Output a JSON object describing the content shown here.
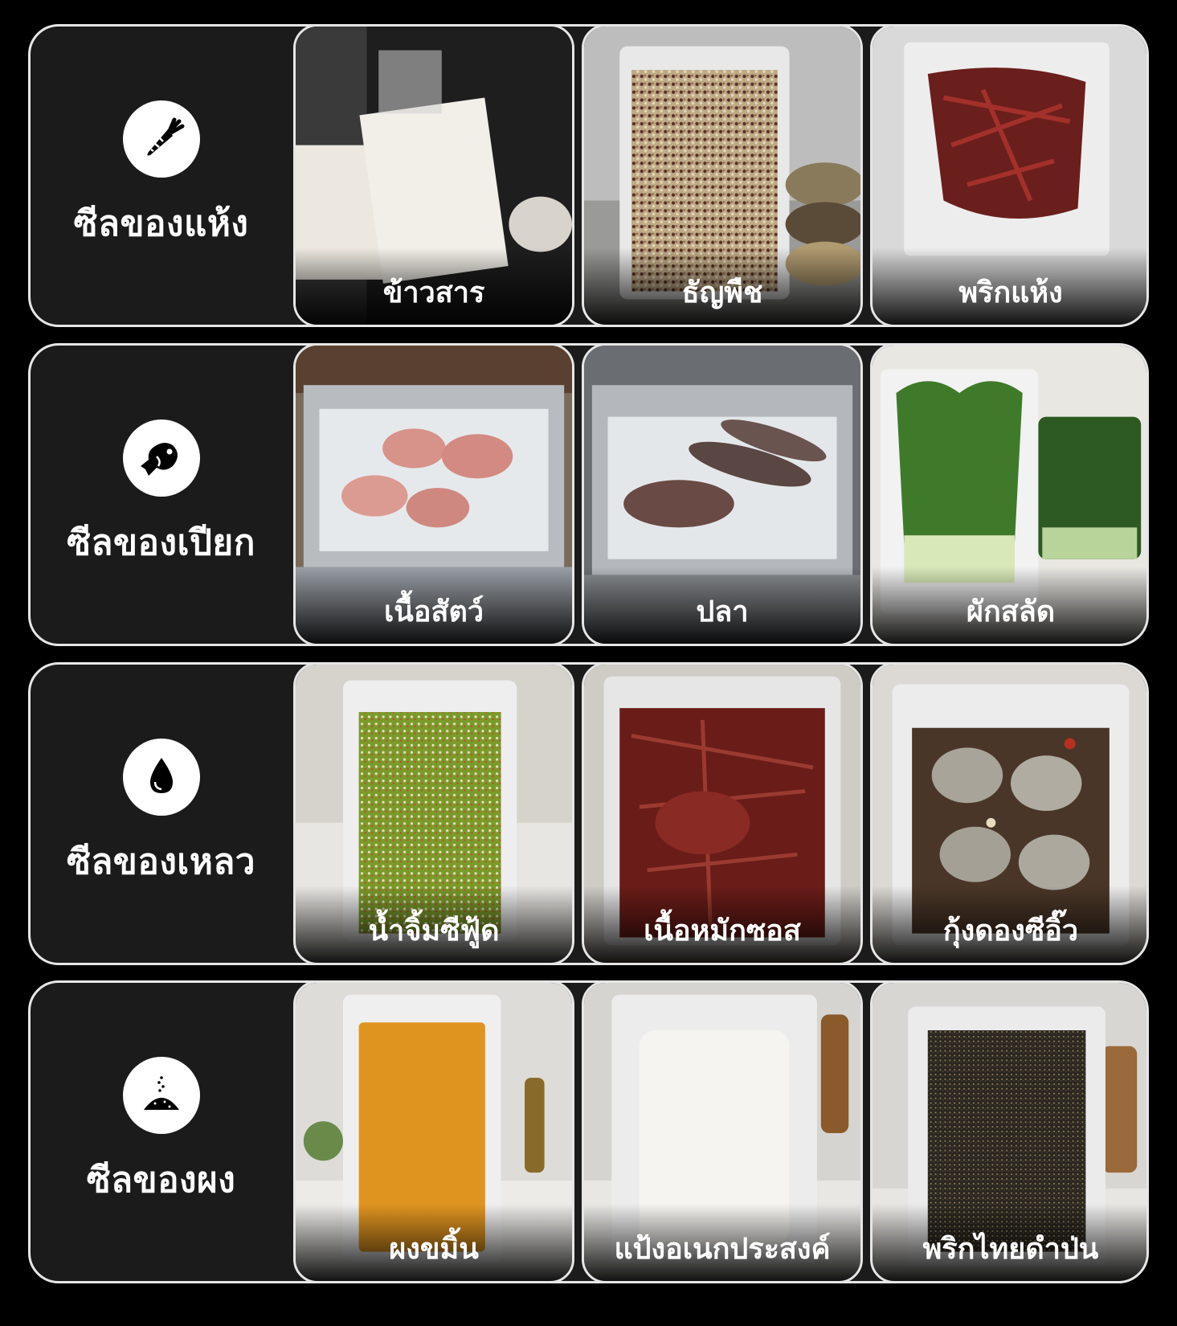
{
  "categories": [
    {
      "label": "ซีลของแห้ง",
      "icon": "carrot-icon",
      "items": [
        {
          "label": "ข้าวสาร",
          "photo": "rice-vacuum-pack-photo"
        },
        {
          "label": "ธัญพืช",
          "photo": "grains-vacuum-pack-photo"
        },
        {
          "label": "พริกแห้ง",
          "photo": "dried-chili-vacuum-pack-photo"
        }
      ]
    },
    {
      "label": "ซีลของเปียก",
      "icon": "fish-icon",
      "items": [
        {
          "label": "เนื้อสัตว์",
          "photo": "meat-in-vacuum-machine-photo"
        },
        {
          "label": "ปลา",
          "photo": "fish-in-vacuum-machine-photo"
        },
        {
          "label": "ผักสลัด",
          "photo": "lettuce-vacuum-pack-photo"
        }
      ]
    },
    {
      "label": "ซีลของเหลว",
      "icon": "water-drop-icon",
      "items": [
        {
          "label": "น้ำจิ้มซีฟู้ด",
          "photo": "seafood-sauce-vacuum-pack-photo"
        },
        {
          "label": "เนื้อหมักซอส",
          "photo": "marinated-beef-vacuum-pack-photo"
        },
        {
          "label": "กุ้งดองซีอิ๊ว",
          "photo": "soy-pickled-shrimp-vacuum-pack-photo"
        }
      ]
    },
    {
      "label": "ซีลของผง",
      "icon": "powder-pile-icon",
      "items": [
        {
          "label": "ผงขมิ้น",
          "photo": "turmeric-powder-vacuum-pack-photo"
        },
        {
          "label": "แป้งอเนกประสงค์",
          "photo": "flour-vacuum-pack-photo"
        },
        {
          "label": "พริกไทยดำป่น",
          "photo": "ground-black-pepper-vacuum-pack-photo"
        }
      ]
    }
  ],
  "colors": {
    "background": "#000000",
    "card": "#1b1b1b",
    "border": "#e6e6e6",
    "text": "#ffffff"
  }
}
